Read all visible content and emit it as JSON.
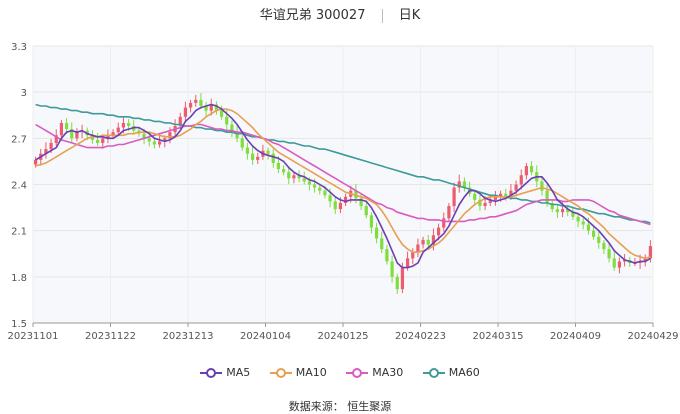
{
  "title": {
    "name": "华谊兄弟 300027",
    "period": "日K"
  },
  "source_text": "数据来源： 恒生聚源",
  "colors": {
    "up": "#ec5c6c",
    "down": "#7ede3e",
    "grid": "#e6e6e6",
    "axis": "#999999"
  },
  "chart_data": {
    "type": "candlestick",
    "ylim": [
      1.5,
      3.3
    ],
    "yticks": [
      "3.3",
      "3",
      "2.7",
      "2.4",
      "2.1",
      "1.8",
      "1.5"
    ],
    "xtick_labels": [
      "20231101",
      "20231122",
      "20231213",
      "20240104",
      "20240125",
      "20240223",
      "20240315",
      "20240409",
      "20240429"
    ],
    "legend": [
      "MA5",
      "MA10",
      "MA30",
      "MA60"
    ],
    "series_colors": {
      "MA5": "#6a3fb5",
      "MA10": "#e8a050",
      "MA30": "#d85cc0",
      "MA60": "#3f9a9a"
    },
    "close": [
      2.56,
      2.6,
      2.63,
      2.67,
      2.72,
      2.8,
      2.76,
      2.7,
      2.74,
      2.75,
      2.72,
      2.69,
      2.67,
      2.7,
      2.72,
      2.74,
      2.77,
      2.8,
      2.78,
      2.75,
      2.73,
      2.7,
      2.68,
      2.66,
      2.68,
      2.7,
      2.74,
      2.78,
      2.84,
      2.9,
      2.93,
      2.95,
      2.91,
      2.88,
      2.92,
      2.88,
      2.84,
      2.79,
      2.74,
      2.7,
      2.64,
      2.6,
      2.56,
      2.58,
      2.62,
      2.6,
      2.54,
      2.5,
      2.48,
      2.44,
      2.46,
      2.44,
      2.42,
      2.4,
      2.38,
      2.36,
      2.33,
      2.29,
      2.24,
      2.28,
      2.32,
      2.36,
      2.31,
      2.26,
      2.2,
      2.12,
      2.05,
      1.98,
      1.9,
      1.8,
      1.72,
      1.86,
      1.92,
      1.96,
      2.01,
      2.04,
      2.01,
      2.07,
      2.12,
      2.18,
      2.26,
      2.38,
      2.42,
      2.38,
      2.34,
      2.3,
      2.26,
      2.28,
      2.3,
      2.32,
      2.34,
      2.32,
      2.36,
      2.4,
      2.46,
      2.52,
      2.48,
      2.42,
      2.36,
      2.28,
      2.24,
      2.22,
      2.24,
      2.22,
      2.19,
      2.16,
      2.14,
      2.1,
      2.06,
      2.02,
      1.98,
      1.92,
      1.86,
      1.9,
      1.91,
      1.89,
      1.89,
      1.9,
      1.92,
      2.0
    ],
    "ma5": [
      2.56,
      2.58,
      2.6,
      2.62,
      2.64,
      2.7,
      2.74,
      2.75,
      2.74,
      2.75,
      2.73,
      2.72,
      2.71,
      2.71,
      2.7,
      2.7,
      2.72,
      2.75,
      2.76,
      2.77,
      2.77,
      2.75,
      2.73,
      2.7,
      2.69,
      2.68,
      2.69,
      2.71,
      2.75,
      2.81,
      2.84,
      2.88,
      2.9,
      2.91,
      2.92,
      2.91,
      2.89,
      2.86,
      2.83,
      2.79,
      2.74,
      2.69,
      2.65,
      2.62,
      2.6,
      2.59,
      2.58,
      2.57,
      2.55,
      2.51,
      2.48,
      2.46,
      2.45,
      2.43,
      2.42,
      2.4,
      2.38,
      2.35,
      2.32,
      2.3,
      2.29,
      2.3,
      2.3,
      2.3,
      2.29,
      2.25,
      2.19,
      2.12,
      2.05,
      1.97,
      1.89,
      1.86,
      1.86,
      1.87,
      1.89,
      1.96,
      1.99,
      2.02,
      2.05,
      2.08,
      2.13,
      2.2,
      2.27,
      2.32,
      2.36,
      2.36,
      2.34,
      2.31,
      2.3,
      2.29,
      2.3,
      2.31,
      2.33,
      2.35,
      2.38,
      2.41,
      2.44,
      2.45,
      2.45,
      2.41,
      2.36,
      2.3,
      2.27,
      2.24,
      2.22,
      2.21,
      2.19,
      2.16,
      2.13,
      2.1,
      2.06,
      2.02,
      1.97,
      1.94,
      1.91,
      1.9,
      1.89,
      1.9,
      1.9,
      1.92
    ],
    "ma10": [
      2.52,
      2.53,
      2.54,
      2.56,
      2.58,
      2.6,
      2.62,
      2.64,
      2.66,
      2.68,
      2.7,
      2.71,
      2.71,
      2.72,
      2.72,
      2.72,
      2.72,
      2.72,
      2.73,
      2.73,
      2.74,
      2.74,
      2.74,
      2.73,
      2.72,
      2.71,
      2.71,
      2.71,
      2.72,
      2.74,
      2.76,
      2.79,
      2.81,
      2.84,
      2.86,
      2.88,
      2.89,
      2.89,
      2.88,
      2.86,
      2.83,
      2.8,
      2.77,
      2.73,
      2.7,
      2.67,
      2.64,
      2.61,
      2.59,
      2.57,
      2.55,
      2.53,
      2.51,
      2.49,
      2.47,
      2.45,
      2.43,
      2.41,
      2.39,
      2.37,
      2.35,
      2.34,
      2.33,
      2.32,
      2.31,
      2.29,
      2.27,
      2.23,
      2.18,
      2.12,
      2.06,
      2.01,
      1.98,
      1.96,
      1.96,
      1.97,
      1.98,
      2.0,
      2.02,
      2.05,
      2.09,
      2.13,
      2.17,
      2.21,
      2.24,
      2.27,
      2.29,
      2.31,
      2.32,
      2.32,
      2.32,
      2.32,
      2.32,
      2.33,
      2.34,
      2.35,
      2.36,
      2.37,
      2.38,
      2.37,
      2.36,
      2.34,
      2.32,
      2.3,
      2.28,
      2.26,
      2.23,
      2.21,
      2.18,
      2.15,
      2.12,
      2.08,
      2.05,
      2.02,
      1.99,
      1.96,
      1.94,
      1.93,
      1.92,
      1.93
    ],
    "ma30": [
      2.79,
      2.77,
      2.75,
      2.73,
      2.71,
      2.69,
      2.68,
      2.67,
      2.66,
      2.65,
      2.64,
      2.64,
      2.64,
      2.64,
      2.65,
      2.65,
      2.66,
      2.66,
      2.67,
      2.68,
      2.69,
      2.7,
      2.71,
      2.72,
      2.73,
      2.74,
      2.75,
      2.76,
      2.77,
      2.78,
      2.78,
      2.79,
      2.79,
      2.78,
      2.77,
      2.76,
      2.76,
      2.75,
      2.75,
      2.74,
      2.74,
      2.73,
      2.72,
      2.71,
      2.7,
      2.69,
      2.67,
      2.66,
      2.64,
      2.62,
      2.6,
      2.58,
      2.56,
      2.54,
      2.52,
      2.5,
      2.48,
      2.46,
      2.44,
      2.42,
      2.4,
      2.38,
      2.36,
      2.34,
      2.32,
      2.3,
      2.28,
      2.27,
      2.25,
      2.24,
      2.22,
      2.21,
      2.2,
      2.19,
      2.18,
      2.18,
      2.17,
      2.17,
      2.17,
      2.16,
      2.16,
      2.16,
      2.16,
      2.16,
      2.17,
      2.17,
      2.18,
      2.18,
      2.19,
      2.19,
      2.2,
      2.21,
      2.22,
      2.23,
      2.25,
      2.27,
      2.28,
      2.29,
      2.3,
      2.3,
      2.3,
      2.3,
      2.29,
      2.29,
      2.3,
      2.3,
      2.3,
      2.3,
      2.29,
      2.27,
      2.25,
      2.23,
      2.22,
      2.2,
      2.19,
      2.18,
      2.17,
      2.16,
      2.15,
      2.14
    ],
    "ma60": [
      2.92,
      2.91,
      2.91,
      2.9,
      2.9,
      2.89,
      2.89,
      2.88,
      2.88,
      2.87,
      2.87,
      2.86,
      2.86,
      2.86,
      2.85,
      2.85,
      2.84,
      2.84,
      2.84,
      2.83,
      2.83,
      2.82,
      2.82,
      2.81,
      2.81,
      2.8,
      2.8,
      2.79,
      2.79,
      2.78,
      2.78,
      2.77,
      2.77,
      2.76,
      2.76,
      2.75,
      2.75,
      2.74,
      2.74,
      2.73,
      2.73,
      2.72,
      2.71,
      2.71,
      2.7,
      2.69,
      2.69,
      2.68,
      2.68,
      2.67,
      2.67,
      2.66,
      2.65,
      2.65,
      2.64,
      2.63,
      2.63,
      2.62,
      2.61,
      2.6,
      2.59,
      2.58,
      2.57,
      2.56,
      2.55,
      2.54,
      2.53,
      2.52,
      2.51,
      2.5,
      2.49,
      2.48,
      2.47,
      2.46,
      2.45,
      2.45,
      2.44,
      2.43,
      2.43,
      2.42,
      2.41,
      2.4,
      2.39,
      2.38,
      2.37,
      2.36,
      2.35,
      2.34,
      2.33,
      2.33,
      2.32,
      2.32,
      2.31,
      2.31,
      2.3,
      2.3,
      2.29,
      2.29,
      2.28,
      2.28,
      2.27,
      2.27,
      2.26,
      2.26,
      2.25,
      2.24,
      2.24,
      2.23,
      2.22,
      2.21,
      2.21,
      2.2,
      2.19,
      2.19,
      2.18,
      2.17,
      2.17,
      2.16,
      2.16,
      2.15
    ]
  }
}
